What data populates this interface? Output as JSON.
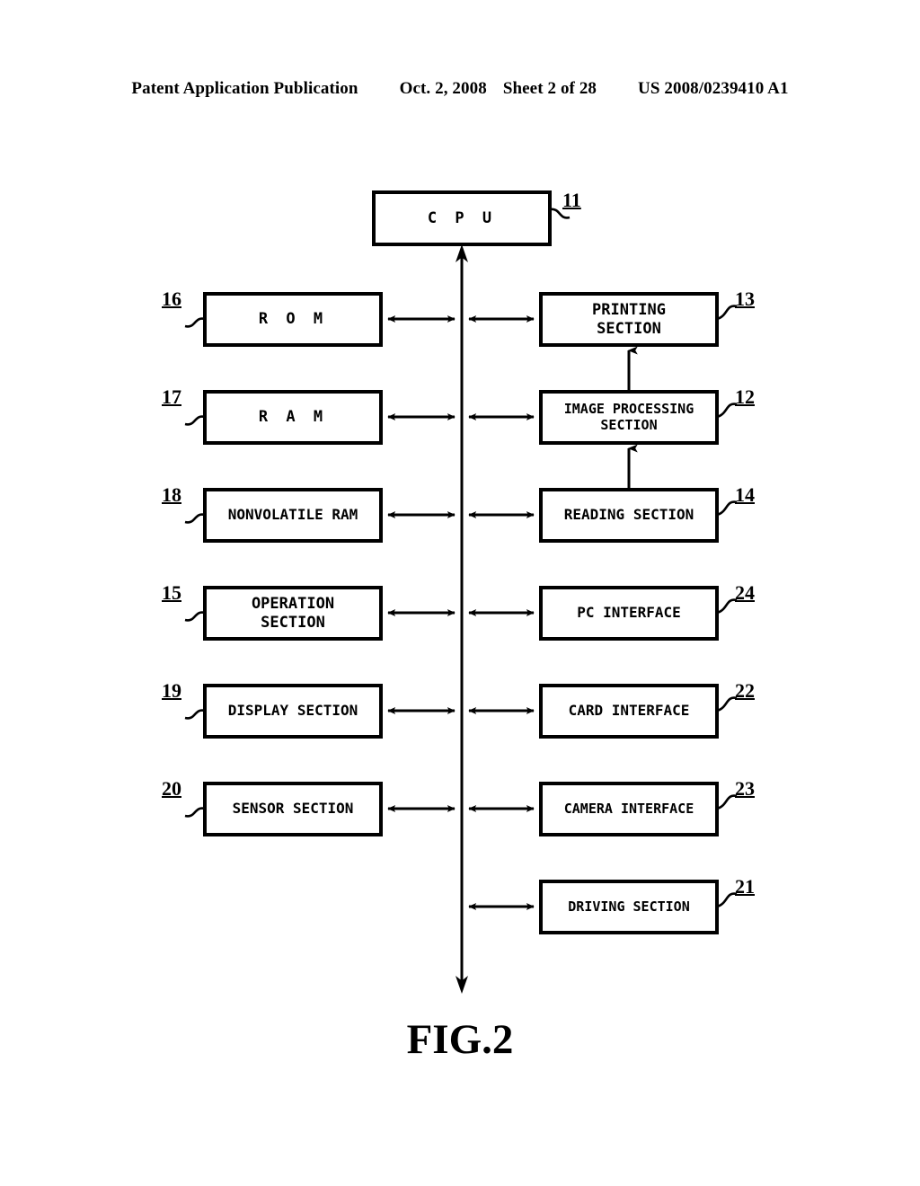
{
  "header": {
    "title": "Patent Application Publication",
    "date": "Oct. 2, 2008",
    "sheet": "Sheet 2 of 28",
    "publication_number": "US 2008/0239410 A1"
  },
  "figure": {
    "caption": "FIG.2",
    "bus": {
      "name": "system-bus",
      "top_arrow": "up",
      "bottom_arrow": "down"
    },
    "cpu": {
      "label": "C P U",
      "ref": "11"
    },
    "left_blocks": [
      {
        "label": "R O M",
        "ref": "16",
        "lines": [
          "R O M"
        ]
      },
      {
        "label": "R A M",
        "ref": "17",
        "lines": [
          "R A M"
        ]
      },
      {
        "label": "NONVOLATILE RAM",
        "ref": "18",
        "lines": [
          "NONVOLATILE RAM"
        ]
      },
      {
        "label": "OPERATION SECTION",
        "ref": "15",
        "lines": [
          "OPERATION",
          "SECTION"
        ]
      },
      {
        "label": "DISPLAY SECTION",
        "ref": "19",
        "lines": [
          "DISPLAY SECTION"
        ]
      },
      {
        "label": "SENSOR SECTION",
        "ref": "20",
        "lines": [
          "SENSOR SECTION"
        ]
      }
    ],
    "right_blocks": [
      {
        "label": "PRINTING SECTION",
        "ref": "13",
        "lines": [
          "PRINTING",
          "SECTION"
        ]
      },
      {
        "label": "IMAGE PROCESSING SECTION",
        "ref": "12",
        "lines": [
          "IMAGE PROCESSING",
          "SECTION"
        ]
      },
      {
        "label": "READING SECTION",
        "ref": "14",
        "lines": [
          "READING SECTION"
        ]
      },
      {
        "label": "PC INTERFACE",
        "ref": "24",
        "lines": [
          "PC INTERFACE"
        ]
      },
      {
        "label": "CARD INTERFACE",
        "ref": "22",
        "lines": [
          "CARD INTERFACE"
        ]
      },
      {
        "label": "CAMERA INTERFACE",
        "ref": "23",
        "lines": [
          "CAMERA INTERFACE"
        ]
      },
      {
        "label": "DRIVING SECTION",
        "ref": "21",
        "lines": [
          "DRIVING SECTION"
        ]
      }
    ]
  },
  "colors": {
    "ink": "#000000",
    "paper": "#ffffff"
  }
}
